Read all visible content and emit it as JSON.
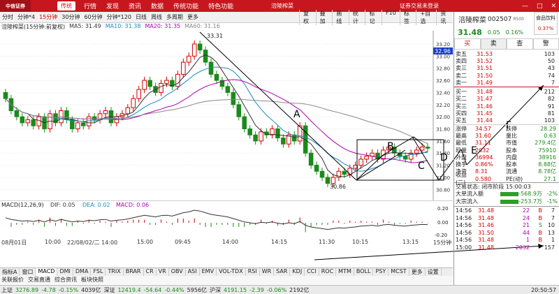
{
  "app": {
    "logo": "中信证券",
    "mode": "传统",
    "menu": [
      "行情",
      "发现",
      "资讯",
      "数据",
      "传统功能",
      "特色功能"
    ],
    "window_title": "涪陵榨菜",
    "login_status": "证券交易未登录",
    "controls": [
      "—",
      "□",
      "✕"
    ]
  },
  "periods": [
    "分时",
    "分钟*4",
    "15分钟",
    "30分钟",
    "60分钟",
    "分钟*120",
    "日线",
    "周线",
    "多周期",
    "更多"
  ],
  "active_period": "15分钟",
  "tools": [
    "复权",
    "叠加",
    "画线",
    "统计",
    "标记"
  ],
  "quick": [
    "F10",
    "标签",
    "+自选",
    "资讯"
  ],
  "ma_line": {
    "name": "涪陵榨菜(15分钟:前复权)",
    "ma5": "MA5: 31.49",
    "ma10": "MA10: 31.38",
    "ma20": "MA20: 31.35",
    "ma60": "MA60: 31.16"
  },
  "price_axis": [
    "33.20",
    "33.00",
    "32.80",
    "32.60",
    "32.40",
    "32.20",
    "32.00",
    "31.80",
    "31.60",
    "31.40",
    "31.20",
    "31.00",
    "30.80"
  ],
  "current_price_tag": "32.96",
  "high_label": "33.31",
  "low_label": "30.86",
  "annotations": {
    "A": "A",
    "B": "B",
    "C": "C",
    "D": "D",
    "E": "E",
    "F": "F"
  },
  "macd": {
    "title": "MACD(12,26,9)",
    "dif": "DIF: 0.05",
    "dea": "DEA: 0.02",
    "macd": "MACD: 0.06",
    "axis": [
      "0.20",
      "0.00",
      "-0.20"
    ]
  },
  "time_axis": [
    "08月01日",
    "10:00",
    "22/08/02/二 14:00",
    "15:00",
    "09:45",
    "14:00",
    "14:15",
    "11:30",
    "10:15",
    "13:15",
    "15分钟"
  ],
  "indicator_tabs": [
    "指标A",
    "窗口",
    "MACD",
    "DMI",
    "DMA",
    "FSL",
    "TRIX",
    "BRAR",
    "CR",
    "VR",
    "OBV",
    "ASI",
    "EMV",
    "VOL-TDX",
    "RSI",
    "WR",
    "SAR",
    "KDJ",
    "CCI",
    "ROC",
    "MTM",
    "BOLL",
    "PSY",
    "MCST",
    "更多",
    "设置"
  ],
  "bottom_tabs": [
    "关联报价",
    "交易直通",
    "综合资讯",
    "板块快照"
  ],
  "status_bar": {
    "sh": "上证",
    "sh_val": "3276.89",
    "sh_chg": "-4.78",
    "sh_pct": "-0.15%",
    "sh_amt": "4039亿",
    "sz": "深证",
    "sz_val": "12419.4",
    "sz_chg": "-54.64",
    "sz_pct": "-0.44%",
    "sz_amt": "5956亿",
    "hs": "沪深",
    "hs_val": "4191.15",
    "hs_chg": "-2.39",
    "hs_pct": "-0.06%",
    "hs_amt": "2192亿",
    "time": "20:50:57"
  },
  "stock": {
    "name": "涪陵榨菜",
    "code": "002507",
    "tag": "R500",
    "price": "31.48",
    "change": "0.05",
    "pct": "0.16%",
    "category": "食品饮料",
    "category_pct": "0.37%"
  },
  "buttons": {
    "buy": "买",
    "sell": "卖",
    "check": "查",
    "alert": "警"
  },
  "asks": [
    {
      "label": "卖五",
      "price": "31.53",
      "vol": "103"
    },
    {
      "label": "卖四",
      "price": "31.52",
      "vol": "50"
    },
    {
      "label": "卖三",
      "price": "31.51",
      "vol": "43"
    },
    {
      "label": "卖二",
      "price": "31.50",
      "vol": "74"
    },
    {
      "label": "卖一",
      "price": "31.49",
      "vol": "7"
    }
  ],
  "bids": [
    {
      "label": "买一",
      "price": "31.48",
      "vol": "212"
    },
    {
      "label": "买二",
      "price": "31.47",
      "vol": "82"
    },
    {
      "label": "买三",
      "price": "31.46",
      "vol": "91"
    },
    {
      "label": "买四",
      "price": "31.45",
      "vol": "81"
    },
    {
      "label": "买五",
      "price": "31.44",
      "vol": "103"
    }
  ],
  "quote": [
    {
      "a": "涨停",
      "b": "34.57",
      "c": "跌停",
      "d": "28.29"
    },
    {
      "a": "最高",
      "b": "31.60",
      "c": "量比",
      "d": "0.63"
    },
    {
      "a": "最低",
      "b": "31.11",
      "c": "市值",
      "d": "279.4亿"
    },
    {
      "a": "现量",
      "b": "2032",
      "c": "股本",
      "d": "75910"
    },
    {
      "a": "外盘",
      "b": "36994",
      "c": "内盘",
      "d": "38916"
    },
    {
      "a": "换手",
      "b": "0.86%",
      "c": "股本",
      "d": "8.88亿"
    },
    {
      "a": "净资",
      "b": "8.31",
      "c": "流通",
      "d": "8.78亿"
    },
    {
      "a": "收益(二)",
      "b": "0.580",
      "c": "PE(动)",
      "d": "27.1"
    }
  ],
  "trade_status": "交易状态: 闭市阶段 15:00:03",
  "flows": [
    {
      "name": "大单流入额",
      "value": "-568.9万",
      "pct": "-2%"
    },
    {
      "name": "大宗流入",
      "value": "-253.7万",
      "pct": "-1%"
    }
  ],
  "ticks": [
    {
      "t": "14:56",
      "p": "31.48",
      "v": "22",
      "s": "B",
      "k": "7"
    },
    {
      "t": "14:56",
      "p": "31.48",
      "v": "24",
      "s": "B",
      "k": "7"
    },
    {
      "t": "14:56",
      "p": "31.46",
      "v": "21",
      "s": "S",
      "k": "10"
    },
    {
      "t": "14:56",
      "p": "31.50",
      "v": "44",
      "s": "B",
      "k": "13"
    },
    {
      "t": "14:56",
      "p": "31.48",
      "v": "1",
      "s": "B",
      "k": "1"
    },
    {
      "t": "15:00",
      "p": "31.48",
      "v": "2032",
      "s": "",
      "k": "157"
    }
  ],
  "chart_data": {
    "type": "candlestick",
    "title": "涪陵榨菜(15分钟:前复权)",
    "y_range": [
      30.7,
      33.35
    ],
    "high": 33.31,
    "low": 30.86,
    "closes": [
      32.3,
      32.1,
      32.0,
      31.9,
      31.95,
      31.85,
      32.0,
      31.8,
      32.05,
      31.9,
      32.1,
      31.95,
      31.8,
      31.9,
      31.85,
      32.0,
      31.95,
      32.05,
      32.1,
      31.9,
      32.0,
      32.05,
      32.15,
      32.3,
      32.45,
      32.6,
      32.5,
      32.4,
      32.55,
      32.6,
      32.5,
      32.7,
      32.9,
      33.0,
      33.2,
      33.1,
      32.9,
      32.7,
      32.6,
      32.5,
      32.4,
      32.2,
      32.0,
      31.8,
      31.7,
      31.6,
      31.75,
      31.7,
      31.8,
      31.65,
      31.55,
      31.7,
      31.6,
      31.85,
      31.4,
      31.2,
      31.1,
      31.0,
      30.9,
      31.0,
      31.1,
      31.05,
      31.15,
      31.2,
      31.3,
      31.35,
      31.4,
      31.3,
      31.45,
      31.5,
      31.4,
      31.35,
      31.3,
      31.4,
      31.45,
      31.5,
      31.48
    ]
  }
}
